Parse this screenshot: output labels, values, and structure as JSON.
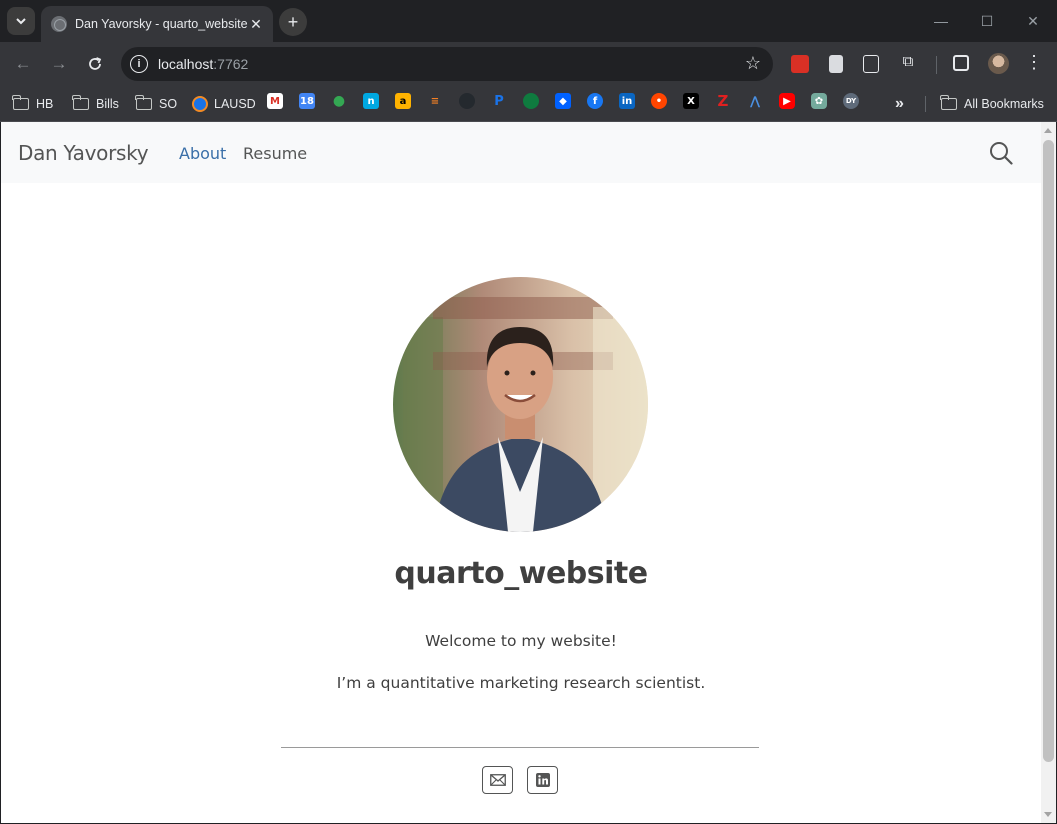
{
  "browser": {
    "tab_title": "Dan Yavorsky - quarto_website",
    "url_host": "localhost",
    "url_port": ":7762",
    "bookmarks": {
      "folders": [
        "HB",
        "Bills",
        "SO"
      ],
      "lausd_label": "LAUSD",
      "all_bookmarks": "All Bookmarks"
    }
  },
  "site": {
    "brand": "Dan Yavorsky",
    "nav": [
      {
        "label": "About"
      },
      {
        "label": "Resume"
      }
    ],
    "title": "quarto_website",
    "paragraphs": [
      "Welcome to my website!",
      "I’m a quantitative marketing research scientist."
    ],
    "social": [
      "email-icon",
      "linkedin-icon"
    ]
  }
}
